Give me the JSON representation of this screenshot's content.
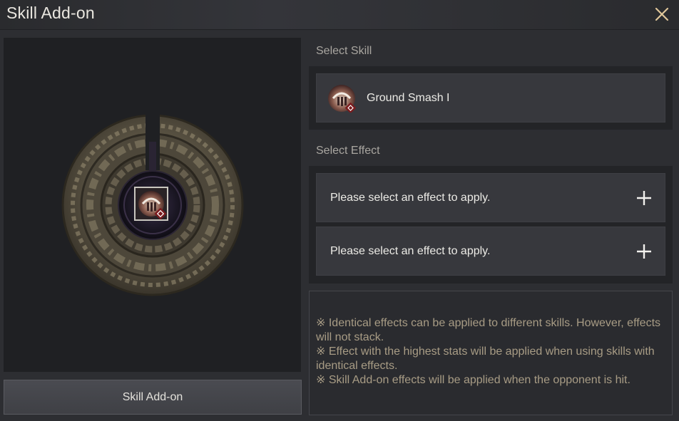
{
  "window": {
    "title": "Skill Add-on",
    "close_icon": "close-icon"
  },
  "preview": {
    "button_label": "Skill Add-on"
  },
  "skill_section": {
    "label": "Select Skill",
    "selected_skill": "Ground Smash I"
  },
  "effect_section": {
    "label": "Select Effect",
    "slots": [
      {
        "text": "Please select an effect to apply."
      },
      {
        "text": "Please select an effect to apply."
      }
    ]
  },
  "notes": [
    "※ Identical effects can be applied to different skills. However, effects will not stack.",
    "※ Effect with the highest stats will be applied when using skills with identical effects.",
    "※ Skill Add-on effects will be applied when the opponent is hit."
  ],
  "colors": {
    "accent_note": "#a89c85",
    "slot_bg": "#37383d",
    "close_icon": "#e0c79a"
  }
}
